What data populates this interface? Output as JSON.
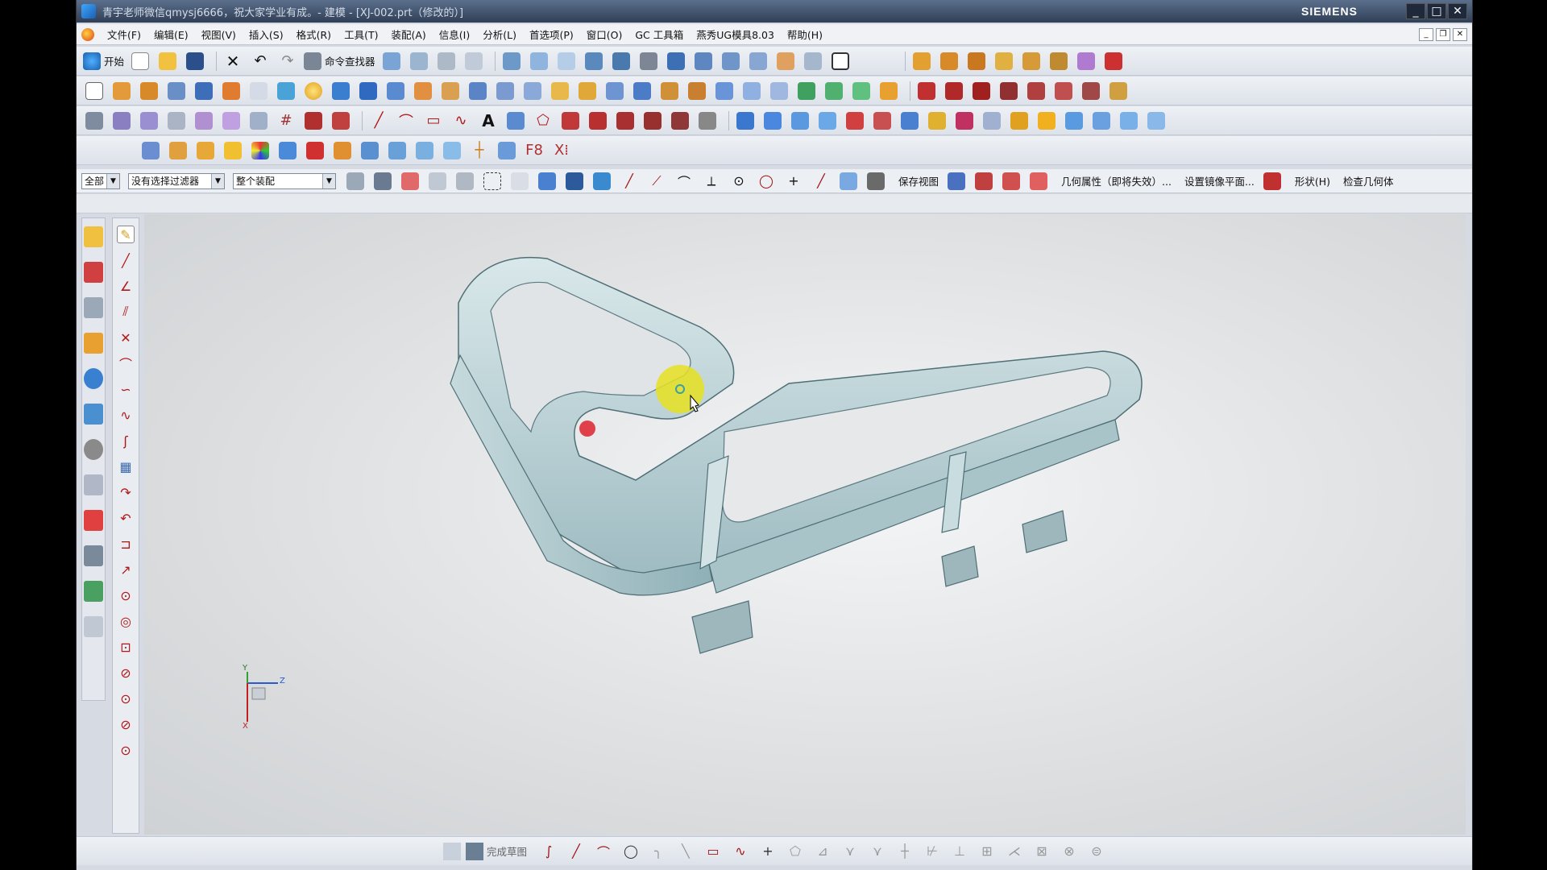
{
  "window": {
    "title": "青宇老师微信qmysj6666，祝大家学业有成。- 建模 - [XJ-002.prt（修改的）]",
    "brand": "SIEMENS",
    "buttons": [
      "minimize-icon",
      "maximize-icon",
      "close-icon"
    ]
  },
  "menubar": {
    "items": [
      "文件(F)",
      "编辑(E)",
      "视图(V)",
      "插入(S)",
      "格式(R)",
      "工具(T)",
      "装配(A)",
      "信息(I)",
      "分析(L)",
      "首选项(P)",
      "窗口(O)",
      "GC 工具箱",
      "燕秀UG模具8.03",
      "帮助(H)"
    ]
  },
  "toolbar1": {
    "start_label": "开始",
    "command_finder_label": "命令查找器"
  },
  "selection_bar": {
    "filter_type": "全部",
    "selection_filter": "没有选择过滤器",
    "scope": "整个装配",
    "save_view_label": "保存视图",
    "geometry_props_label": "几何属性（即将失效）...",
    "mirror_plane_label": "设置镜像平面...",
    "shape_label": "形状(H)",
    "check_geometry_label": "检查几何体"
  },
  "sketch_bar": {
    "finish_sketch_label": "完成草图"
  },
  "triad": {
    "y_label": "Y",
    "z_label": "Z",
    "x_label": "X"
  },
  "colors": {
    "title_bar": "#2f3f56",
    "part_fill": "#bcd3d8",
    "highlight": "#e6e020",
    "marker": "#e0404a"
  }
}
